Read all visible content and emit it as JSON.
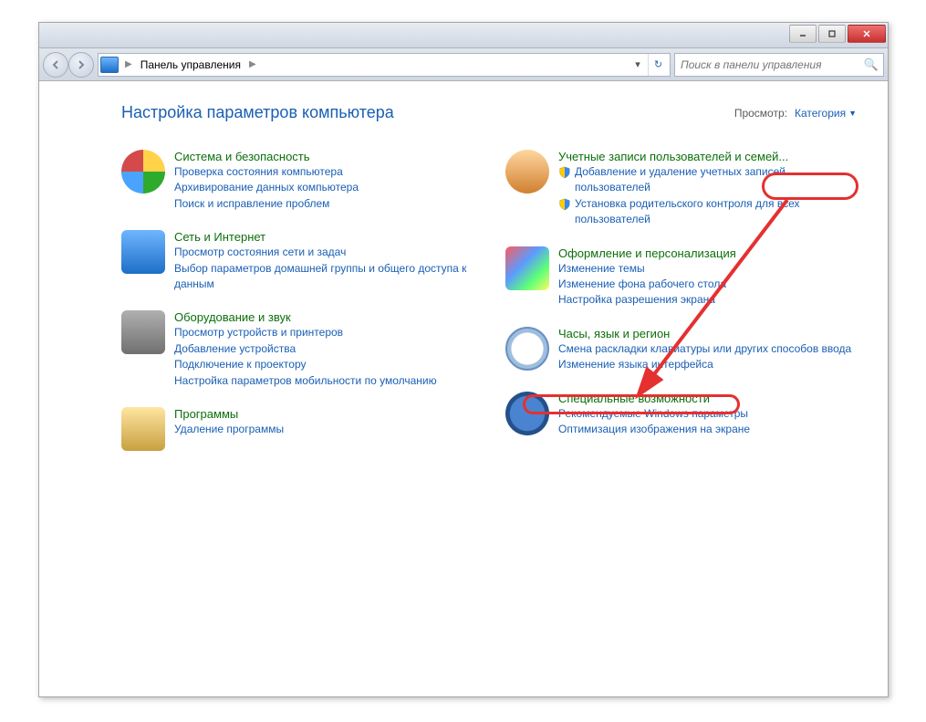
{
  "chrome": {
    "breadcrumb": "Панель управления",
    "search_placeholder": "Поиск в панели управления"
  },
  "header": {
    "title": "Настройка параметров компьютера",
    "view_label": "Просмотр:",
    "view_value": "Категория"
  },
  "left_categories": [
    {
      "title": "Система и безопасность",
      "links": [
        "Проверка состояния компьютера",
        "Архивирование данных компьютера",
        "Поиск и исправление проблем"
      ]
    },
    {
      "title": "Сеть и Интернет",
      "links": [
        "Просмотр состояния сети и задач",
        "Выбор параметров домашней группы и общего доступа к данным"
      ]
    },
    {
      "title": "Оборудование и звук",
      "links": [
        "Просмотр устройств и принтеров",
        "Добавление устройства",
        "Подключение к проектору",
        "Настройка параметров мобильности по умолчанию"
      ]
    },
    {
      "title": "Программы",
      "links": [
        "Удаление программы"
      ]
    }
  ],
  "right_categories": [
    {
      "title": "Учетные записи пользователей и семей...",
      "shield_links": [
        "Добавление и удаление учетных записей пользователей",
        "Установка родительского контроля для всех пользователей"
      ]
    },
    {
      "title": "Оформление и персонализация",
      "links": [
        "Изменение темы",
        "Изменение фона рабочего стола",
        "Настройка разрешения экрана"
      ]
    },
    {
      "title": "Часы, язык и регион",
      "links": [
        "Смена раскладки клавиатуры или других способов ввода",
        "Изменение языка интерфейса"
      ]
    },
    {
      "title": "Специальные возможности",
      "links": [
        "Рекомендуемые Windows параметры",
        "Оптимизация изображения на экране"
      ]
    }
  ]
}
